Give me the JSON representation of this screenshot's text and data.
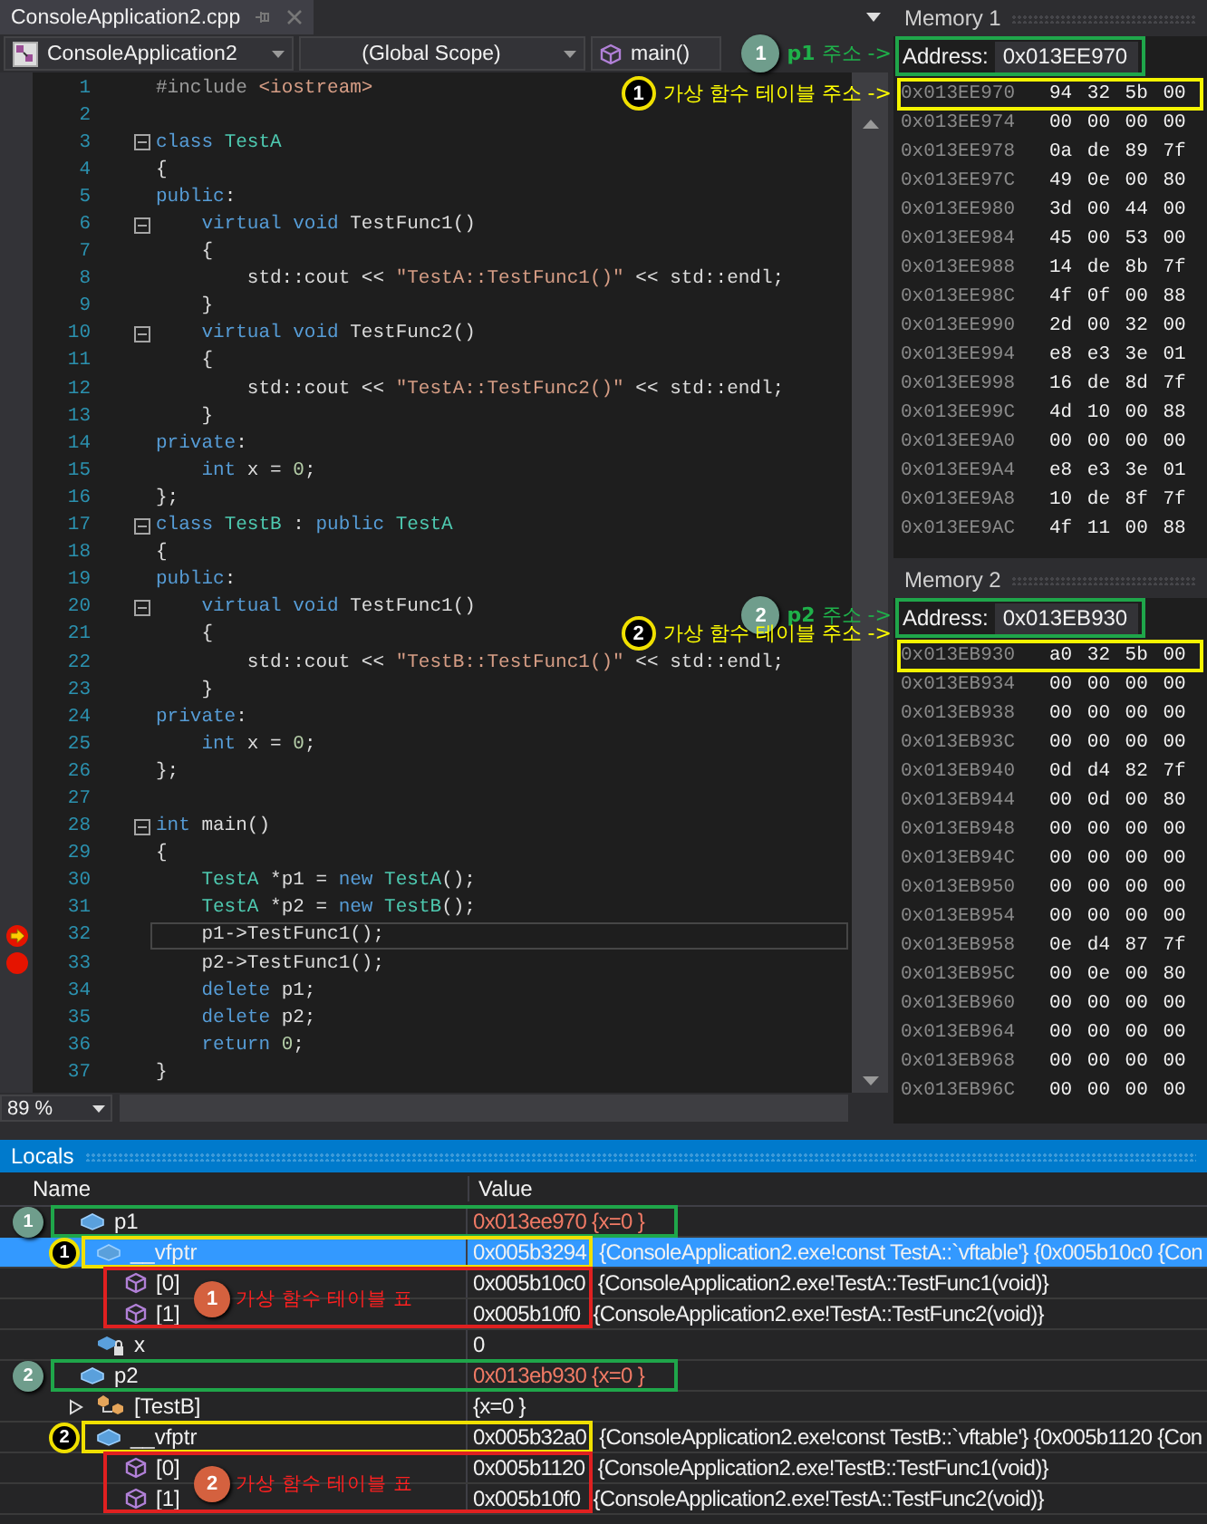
{
  "editor": {
    "file_tab": "ConsoleApplication2.cpp",
    "nav": [
      {
        "kind": "project",
        "text": "ConsoleApplication2"
      },
      {
        "kind": "scope",
        "text": "(Global Scope)"
      },
      {
        "kind": "member",
        "text": "main()"
      }
    ],
    "lines": [
      {
        "number": "1",
        "fold": false,
        "breakpoint": false,
        "current": false,
        "tokens": [
          {
            "kind": "pre",
            "text": "#include "
          },
          {
            "kind": "str",
            "text": "<iostream>"
          }
        ]
      },
      {
        "number": "2",
        "fold": false,
        "breakpoint": false,
        "current": false
      },
      {
        "number": "3",
        "fold": true,
        "breakpoint": false,
        "current": false,
        "tokens": [
          {
            "kind": "kw",
            "text": "class "
          },
          {
            "kind": "type",
            "text": "TestA"
          }
        ]
      },
      {
        "number": "4",
        "fold": false,
        "breakpoint": false,
        "current": false,
        "tokens": [
          {
            "kind": "plain",
            "text": "{"
          }
        ]
      },
      {
        "number": "5",
        "fold": false,
        "breakpoint": false,
        "current": false,
        "tokens": [
          {
            "kind": "kw",
            "text": "public"
          },
          {
            "kind": "plain",
            "text": ":"
          }
        ]
      },
      {
        "number": "6",
        "fold": true,
        "breakpoint": false,
        "current": false,
        "tokens": [
          {
            "kind": "kw",
            "text": "    virtual void"
          },
          {
            "kind": "plain",
            "text": " TestFunc1()"
          }
        ]
      },
      {
        "number": "7",
        "fold": false,
        "breakpoint": false,
        "current": false,
        "tokens": [
          {
            "kind": "plain",
            "text": "    {"
          }
        ]
      },
      {
        "number": "8",
        "fold": false,
        "breakpoint": false,
        "current": false,
        "tokens": [
          {
            "kind": "plain",
            "text": "        std::cout << "
          },
          {
            "kind": "str",
            "text": "\"TestA::TestFunc1()\""
          },
          {
            "kind": "plain",
            "text": " << std::endl;"
          }
        ]
      },
      {
        "number": "9",
        "fold": false,
        "breakpoint": false,
        "current": false,
        "tokens": [
          {
            "kind": "plain",
            "text": "    }"
          }
        ]
      },
      {
        "number": "10",
        "fold": true,
        "breakpoint": false,
        "current": false,
        "tokens": [
          {
            "kind": "kw",
            "text": "    virtual void"
          },
          {
            "kind": "plain",
            "text": " TestFunc2()"
          }
        ]
      },
      {
        "number": "11",
        "fold": false,
        "breakpoint": false,
        "current": false,
        "tokens": [
          {
            "kind": "plain",
            "text": "    {"
          }
        ]
      },
      {
        "number": "12",
        "fold": false,
        "breakpoint": false,
        "current": false,
        "tokens": [
          {
            "kind": "plain",
            "text": "        std::cout << "
          },
          {
            "kind": "str",
            "text": "\"TestA::TestFunc2()\""
          },
          {
            "kind": "plain",
            "text": " << std::endl;"
          }
        ]
      },
      {
        "number": "13",
        "fold": false,
        "breakpoint": false,
        "current": false,
        "tokens": [
          {
            "kind": "plain",
            "text": "    }"
          }
        ]
      },
      {
        "number": "14",
        "fold": false,
        "breakpoint": false,
        "current": false,
        "tokens": [
          {
            "kind": "kw",
            "text": "private"
          },
          {
            "kind": "plain",
            "text": ":"
          }
        ]
      },
      {
        "number": "15",
        "fold": false,
        "breakpoint": false,
        "current": false,
        "tokens": [
          {
            "kind": "kw",
            "text": "    int"
          },
          {
            "kind": "plain",
            "text": " x = "
          },
          {
            "kind": "num",
            "text": "0"
          },
          {
            "kind": "plain",
            "text": ";"
          }
        ]
      },
      {
        "number": "16",
        "fold": false,
        "breakpoint": false,
        "current": false,
        "tokens": [
          {
            "kind": "plain",
            "text": "};"
          }
        ]
      },
      {
        "number": "17",
        "fold": true,
        "breakpoint": false,
        "current": false,
        "tokens": [
          {
            "kind": "kw",
            "text": "class "
          },
          {
            "kind": "type",
            "text": "TestB"
          },
          {
            "kind": "plain",
            "text": " : "
          },
          {
            "kind": "kw",
            "text": "public "
          },
          {
            "kind": "type",
            "text": "TestA"
          }
        ]
      },
      {
        "number": "18",
        "fold": false,
        "breakpoint": false,
        "current": false,
        "tokens": [
          {
            "kind": "plain",
            "text": "{"
          }
        ]
      },
      {
        "number": "19",
        "fold": false,
        "breakpoint": false,
        "current": false,
        "tokens": [
          {
            "kind": "kw",
            "text": "public"
          },
          {
            "kind": "plain",
            "text": ":"
          }
        ]
      },
      {
        "number": "20",
        "fold": true,
        "breakpoint": false,
        "current": false,
        "tokens": [
          {
            "kind": "kw",
            "text": "    virtual void"
          },
          {
            "kind": "plain",
            "text": " TestFunc1()"
          }
        ]
      },
      {
        "number": "21",
        "fold": false,
        "breakpoint": false,
        "current": false,
        "tokens": [
          {
            "kind": "plain",
            "text": "    {"
          }
        ]
      },
      {
        "number": "22",
        "fold": false,
        "breakpoint": false,
        "current": false,
        "tokens": [
          {
            "kind": "plain",
            "text": "        std::cout << "
          },
          {
            "kind": "str",
            "text": "\"TestB::TestFunc1()\""
          },
          {
            "kind": "plain",
            "text": " << std::endl;"
          }
        ]
      },
      {
        "number": "23",
        "fold": false,
        "breakpoint": false,
        "current": false,
        "tokens": [
          {
            "kind": "plain",
            "text": "    }"
          }
        ]
      },
      {
        "number": "24",
        "fold": false,
        "breakpoint": false,
        "current": false,
        "tokens": [
          {
            "kind": "kw",
            "text": "private"
          },
          {
            "kind": "plain",
            "text": ":"
          }
        ]
      },
      {
        "number": "25",
        "fold": false,
        "breakpoint": false,
        "current": false,
        "tokens": [
          {
            "kind": "kw",
            "text": "    int"
          },
          {
            "kind": "plain",
            "text": " x = "
          },
          {
            "kind": "num",
            "text": "0"
          },
          {
            "kind": "plain",
            "text": ";"
          }
        ]
      },
      {
        "number": "26",
        "fold": false,
        "breakpoint": false,
        "current": false,
        "tokens": [
          {
            "kind": "plain",
            "text": "};"
          }
        ]
      },
      {
        "number": "27",
        "fold": false,
        "breakpoint": false,
        "current": false
      },
      {
        "number": "28",
        "fold": true,
        "breakpoint": false,
        "current": false,
        "tokens": [
          {
            "kind": "kw",
            "text": "int"
          },
          {
            "kind": "plain",
            "text": " main()"
          }
        ]
      },
      {
        "number": "29",
        "fold": false,
        "breakpoint": false,
        "current": false,
        "tokens": [
          {
            "kind": "plain",
            "text": "{"
          }
        ]
      },
      {
        "number": "30",
        "fold": false,
        "breakpoint": false,
        "current": false,
        "tokens": [
          {
            "kind": "type",
            "text": "    TestA"
          },
          {
            "kind": "plain",
            "text": " *p1 = "
          },
          {
            "kind": "kw",
            "text": "new "
          },
          {
            "kind": "type",
            "text": "TestA"
          },
          {
            "kind": "plain",
            "text": "();"
          }
        ]
      },
      {
        "number": "31",
        "fold": false,
        "breakpoint": false,
        "current": false,
        "tokens": [
          {
            "kind": "type",
            "text": "    TestA"
          },
          {
            "kind": "plain",
            "text": " *p2 = "
          },
          {
            "kind": "kw",
            "text": "new "
          },
          {
            "kind": "type",
            "text": "TestB"
          },
          {
            "kind": "plain",
            "text": "();"
          }
        ]
      },
      {
        "number": "32",
        "fold": false,
        "breakpoint": true,
        "current": true,
        "tokens": [
          {
            "kind": "plain",
            "text": "    p1->TestFunc1();"
          }
        ]
      },
      {
        "number": "33",
        "fold": false,
        "breakpoint": true,
        "current": false,
        "tokens": [
          {
            "kind": "plain",
            "text": "    p2->TestFunc1();"
          }
        ]
      },
      {
        "number": "34",
        "fold": false,
        "breakpoint": false,
        "current": false,
        "tokens": [
          {
            "kind": "kw",
            "text": "    delete"
          },
          {
            "kind": "plain",
            "text": " p1;"
          }
        ]
      },
      {
        "number": "35",
        "fold": false,
        "breakpoint": false,
        "current": false,
        "tokens": [
          {
            "kind": "kw",
            "text": "    delete"
          },
          {
            "kind": "plain",
            "text": " p2;"
          }
        ]
      },
      {
        "number": "36",
        "fold": false,
        "breakpoint": false,
        "current": false,
        "tokens": [
          {
            "kind": "kw",
            "text": "    return "
          },
          {
            "kind": "num",
            "text": "0"
          },
          {
            "kind": "plain",
            "text": ";"
          }
        ]
      },
      {
        "number": "37",
        "fold": false,
        "breakpoint": false,
        "current": false,
        "tokens": [
          {
            "kind": "plain",
            "text": "}"
          }
        ]
      }
    ],
    "zoom": "89 %"
  },
  "memory": [
    {
      "title": "Memory 1",
      "address_label": "Address:",
      "address": "0x013EE970",
      "address_note": {
        "badge": "1",
        "label": "**p1** 주소 ->"
      },
      "rows": [
        {
          "address": "0x013EE970",
          "bytes": "94 32 5b 00",
          "highlighted": true,
          "note": {
            "badge": "1",
            "label": "가상 함수 테이블 주소 ->"
          }
        },
        {
          "address": "0x013EE974",
          "bytes": "00 00 00 00",
          "highlighted": false
        },
        {
          "address": "0x013EE978",
          "bytes": "0a de 89 7f",
          "highlighted": false
        },
        {
          "address": "0x013EE97C",
          "bytes": "49 0e 00 80",
          "highlighted": false
        },
        {
          "address": "0x013EE980",
          "bytes": "3d 00 44 00",
          "highlighted": false
        },
        {
          "address": "0x013EE984",
          "bytes": "45 00 53 00",
          "highlighted": false
        },
        {
          "address": "0x013EE988",
          "bytes": "14 de 8b 7f",
          "highlighted": false
        },
        {
          "address": "0x013EE98C",
          "bytes": "4f 0f 00 88",
          "highlighted": false
        },
        {
          "address": "0x013EE990",
          "bytes": "2d 00 32 00",
          "highlighted": false
        },
        {
          "address": "0x013EE994",
          "bytes": "e8 e3 3e 01",
          "highlighted": false
        },
        {
          "address": "0x013EE998",
          "bytes": "16 de 8d 7f",
          "highlighted": false
        },
        {
          "address": "0x013EE99C",
          "bytes": "4d 10 00 88",
          "highlighted": false
        },
        {
          "address": "0x013EE9A0",
          "bytes": "00 00 00 00",
          "highlighted": false
        },
        {
          "address": "0x013EE9A4",
          "bytes": "e8 e3 3e 01",
          "highlighted": false
        },
        {
          "address": "0x013EE9A8",
          "bytes": "10 de 8f 7f",
          "highlighted": false
        },
        {
          "address": "0x013EE9AC",
          "bytes": "4f 11 00 88",
          "highlighted": false
        }
      ]
    },
    {
      "title": "Memory 2",
      "address_label": "Address:",
      "address": "0x013EB930",
      "address_note": {
        "badge": "2",
        "label": "**p2** 주소 ->"
      },
      "rows": [
        {
          "address": "0x013EB930",
          "bytes": "a0 32 5b 00",
          "highlighted": true,
          "note": {
            "badge": "2",
            "label": "가상 함수 테이블 주소 ->"
          }
        },
        {
          "address": "0x013EB934",
          "bytes": "00 00 00 00",
          "highlighted": false
        },
        {
          "address": "0x013EB938",
          "bytes": "00 00 00 00",
          "highlighted": false
        },
        {
          "address": "0x013EB93C",
          "bytes": "00 00 00 00",
          "highlighted": false
        },
        {
          "address": "0x013EB940",
          "bytes": "0d d4 82 7f",
          "highlighted": false
        },
        {
          "address": "0x013EB944",
          "bytes": "00 0d 00 80",
          "highlighted": false
        },
        {
          "address": "0x013EB948",
          "bytes": "00 00 00 00",
          "highlighted": false
        },
        {
          "address": "0x013EB94C",
          "bytes": "00 00 00 00",
          "highlighted": false
        },
        {
          "address": "0x013EB950",
          "bytes": "00 00 00 00",
          "highlighted": false
        },
        {
          "address": "0x013EB954",
          "bytes": "00 00 00 00",
          "highlighted": false
        },
        {
          "address": "0x013EB958",
          "bytes": "0e d4 87 7f",
          "highlighted": false
        },
        {
          "address": "0x013EB95C",
          "bytes": "00 0e 00 80",
          "highlighted": false
        },
        {
          "address": "0x013EB960",
          "bytes": "00 00 00 00",
          "highlighted": false
        },
        {
          "address": "0x013EB964",
          "bytes": "00 00 00 00",
          "highlighted": false
        },
        {
          "address": "0x013EB968",
          "bytes": "00 00 00 00",
          "highlighted": false
        },
        {
          "address": "0x013EB96C",
          "bytes": "00 00 00 00",
          "highlighted": false
        }
      ]
    }
  ],
  "locals": {
    "title": "Locals",
    "columns": [
      "Name",
      "Value"
    ],
    "items": [
      {
        "name": "p1",
        "kind": "variable",
        "value": "0x013ee970 {x=0 }",
        "changed": true,
        "selected": false,
        "note": {
          "badge": "1"
        },
        "children": [
          {
            "name": "__vfptr",
            "kind": "variable",
            "value": "0x005b3294",
            "detail": "{ConsoleApplication2.exe!const TestA::`vftable'} {0x005b10c0 {Con",
            "changed": false,
            "selected": true,
            "note": {
              "badge": "1"
            },
            "group_note": {
              "badge": "1",
              "label": "가상 함수 테이블 표"
            },
            "children": [
              {
                "name": "[0]",
                "kind": "method",
                "value": "0x005b10c0",
                "detail": "{ConsoleApplication2.exe!TestA::TestFunc1(void)}",
                "changed": false,
                "selected": false
              },
              {
                "name": "[1]",
                "kind": "method",
                "value": "0x005b10f0",
                "detail": "{ConsoleApplication2.exe!TestA::TestFunc2(void)}",
                "changed": false,
                "selected": false
              }
            ]
          },
          {
            "name": "x",
            "kind": "private-field",
            "value": "0",
            "changed": false,
            "selected": false
          }
        ]
      },
      {
        "name": "p2",
        "kind": "variable",
        "value": "0x013eb930 {x=0 }",
        "changed": true,
        "selected": false,
        "note": {
          "badge": "2"
        },
        "children": [
          {
            "name": "[TestB]",
            "kind": "base-class",
            "value": "{x=0 }",
            "changed": false,
            "selected": false,
            "expanded": false
          },
          {
            "name": "__vfptr",
            "kind": "variable",
            "value": "0x005b32a0",
            "detail": "{ConsoleApplication2.exe!const TestB::`vftable'} {0x005b1120 {Con",
            "changed": false,
            "selected": false,
            "note": {
              "badge": "2"
            },
            "group_note": {
              "badge": "2",
              "label": "가상 함수 테이블 표"
            },
            "children": [
              {
                "name": "[0]",
                "kind": "method",
                "value": "0x005b1120",
                "detail": "{ConsoleApplication2.exe!TestB::TestFunc1(void)}",
                "changed": false,
                "selected": false
              },
              {
                "name": "[1]",
                "kind": "method",
                "value": "0x005b10f0",
                "detail": "{ConsoleApplication2.exe!TestA::TestFunc2(void)}",
                "changed": false,
                "selected": false
              }
            ]
          }
        ]
      }
    ]
  }
}
